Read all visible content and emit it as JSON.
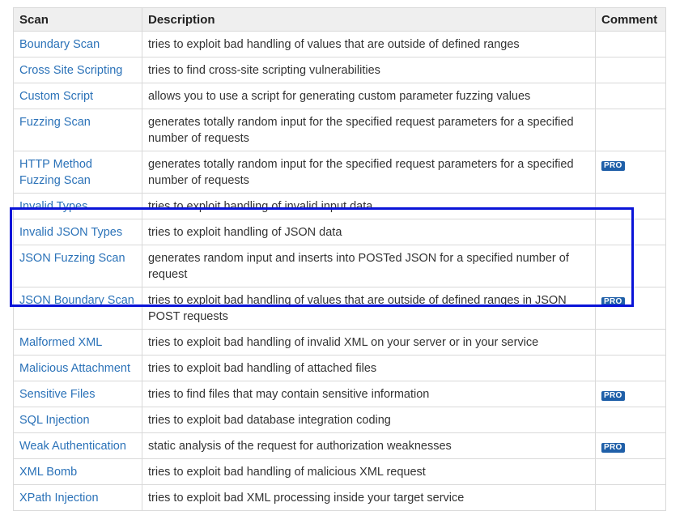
{
  "header": {
    "scan": "Scan",
    "description": "Description",
    "comment": "Comment"
  },
  "rows": [
    {
      "scan": "Boundary Scan",
      "description": "tries to exploit bad handling of values that are outside of defined ranges",
      "comment": ""
    },
    {
      "scan": "Cross Site Scripting",
      "description": "tries to find cross-site scripting vulnerabilities",
      "comment": ""
    },
    {
      "scan": "Custom Script",
      "description": "allows you to use a script for generating custom parameter fuzzing values",
      "comment": ""
    },
    {
      "scan": "Fuzzing Scan",
      "description": "generates totally random input for the specified request parameters for a specified number of requests",
      "comment": ""
    },
    {
      "scan": "HTTP Method Fuzzing Scan",
      "description": "generates totally random input for the specified request parameters for a specified number of requests",
      "comment": "PRO"
    },
    {
      "scan": "Invalid Types",
      "description": "tries to exploit handling of invalid input data",
      "comment": ""
    },
    {
      "scan": "Invalid JSON Types",
      "description": "tries to exploit handling of JSON data",
      "comment": ""
    },
    {
      "scan": "JSON Fuzzing Scan",
      "description": "generates random input and inserts into POSTed JSON for a specified number of request",
      "comment": ""
    },
    {
      "scan": "JSON Boundary Scan",
      "description": "tries to exploit bad handling of values that are outside of defined ranges in JSON POST requests",
      "comment": "PRO"
    },
    {
      "scan": "Malformed XML",
      "description": "tries to exploit bad handling of invalid XML on your server or in your service",
      "comment": ""
    },
    {
      "scan": "Malicious Attachment",
      "description": "tries to exploit bad handling of attached files",
      "comment": ""
    },
    {
      "scan": "Sensitive Files",
      "description": "tries to find files that may contain sensitive information",
      "comment": "PRO"
    },
    {
      "scan": "SQL Injection",
      "description": "tries to exploit bad database integration coding",
      "comment": ""
    },
    {
      "scan": "Weak Authentication",
      "description": "static analysis of the request for authorization weaknesses",
      "comment": "PRO"
    },
    {
      "scan": "XML Bomb",
      "description": "tries to exploit bad handling of malicious XML request",
      "comment": ""
    },
    {
      "scan": "XPath Injection",
      "description": "tries to exploit bad XML processing inside your target service",
      "comment": ""
    }
  ],
  "colors": {
    "link": "#2b72b8",
    "pro_badge": "#1f5fa8",
    "highlight": "#0a14d8",
    "header_bg": "#efefef"
  }
}
